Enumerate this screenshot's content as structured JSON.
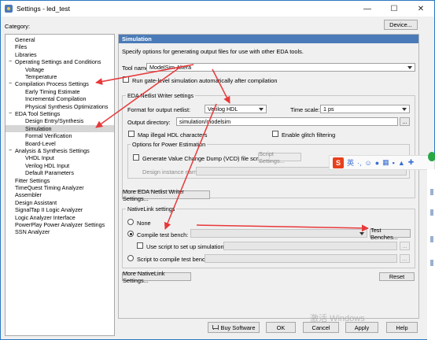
{
  "window": {
    "title": "Settings - led_test",
    "minimize": "—",
    "maximize": "☐",
    "close": "✕"
  },
  "category_label": "Category:",
  "device_button": "Device...",
  "tree": [
    {
      "label": "General",
      "indent": 0
    },
    {
      "label": "Files",
      "indent": 0
    },
    {
      "label": "Libraries",
      "indent": 0
    },
    {
      "label": "Operating Settings and Conditions",
      "indent": 0,
      "expander": "−"
    },
    {
      "label": "Voltage",
      "indent": 1
    },
    {
      "label": "Temperature",
      "indent": 1
    },
    {
      "label": "Compilation Process Settings",
      "indent": 0,
      "expander": "−"
    },
    {
      "label": "Early Timing Estimate",
      "indent": 1
    },
    {
      "label": "Incremental Compilation",
      "indent": 1
    },
    {
      "label": "Physical Synthesis Optimizations",
      "indent": 1
    },
    {
      "label": "EDA Tool Settings",
      "indent": 0,
      "expander": "−"
    },
    {
      "label": "Design Entry/Synthesis",
      "indent": 1
    },
    {
      "label": "Simulation",
      "indent": 1,
      "selected": true
    },
    {
      "label": "Formal Verification",
      "indent": 1
    },
    {
      "label": "Board-Level",
      "indent": 1
    },
    {
      "label": "Analysis & Synthesis Settings",
      "indent": 0,
      "expander": "−"
    },
    {
      "label": "VHDL Input",
      "indent": 1
    },
    {
      "label": "Verilog HDL Input",
      "indent": 1
    },
    {
      "label": "Default Parameters",
      "indent": 1
    },
    {
      "label": "Fitter Settings",
      "indent": 0
    },
    {
      "label": "TimeQuest Timing Analyzer",
      "indent": 0
    },
    {
      "label": "Assembler",
      "indent": 0
    },
    {
      "label": "Design Assistant",
      "indent": 0
    },
    {
      "label": "SignalTap II Logic Analyzer",
      "indent": 0
    },
    {
      "label": "Logic Analyzer Interface",
      "indent": 0
    },
    {
      "label": "PowerPlay Power Analyzer Settings",
      "indent": 0
    },
    {
      "label": "SSN Analyzer",
      "indent": 0
    }
  ],
  "panel": {
    "header": "Simulation",
    "description": "Specify options for generating output files for use with other EDA tools.",
    "tool_name_label": "Tool name:",
    "tool_name_value": "ModelSim-Altera",
    "run_gate_level_label": "Run gate-level simulation automatically after compilation",
    "eda_netlist_group": "EDA Netlist Writer settings",
    "format_label": "Format for output netlist:",
    "format_value": "Verilog HDL",
    "time_scale_label": "Time scale:",
    "time_scale_value": "1 ps",
    "output_dir_label": "Output directory:",
    "output_dir_value": "simulation/modelsim",
    "browse_label": "...",
    "map_illegal_label": "Map illegal HDL characters",
    "enable_glitch_label": "Enable glitch filtering",
    "power_group": "Options for Power Estimation",
    "generate_vcd_label": "Generate Value Change Dump (VCD) file script",
    "script_settings_button": "Script Settings...",
    "design_instance_label": "Design instance name:",
    "more_eda_button": "More EDA Netlist Writer Settings...",
    "nativelink_group": "NativeLink settings",
    "none_label": "None",
    "compile_tb_label": "Compile test bench:",
    "test_benches_button": "Test Benches...",
    "use_script_label": "Use script to set up simulation:",
    "script_compile_label": "Script to compile test bench:",
    "more_nativelink_button": "More NativeLink Settings...",
    "reset_button": "Reset"
  },
  "bottom": {
    "buy_software": "Buy Software",
    "ok": "OK",
    "cancel": "Cancel",
    "apply": "Apply",
    "help": "Help"
  },
  "watermark": "激活 Windows",
  "ime": {
    "logo": "S",
    "lang": "英",
    "icons": [
      "·,",
      "☺",
      "mic-icon",
      "keyboard-icon",
      "skin-icon",
      "shirt-icon",
      "tools-icon"
    ]
  },
  "annotation_color": "#e8383a",
  "accent_color": "#4a7bb8"
}
